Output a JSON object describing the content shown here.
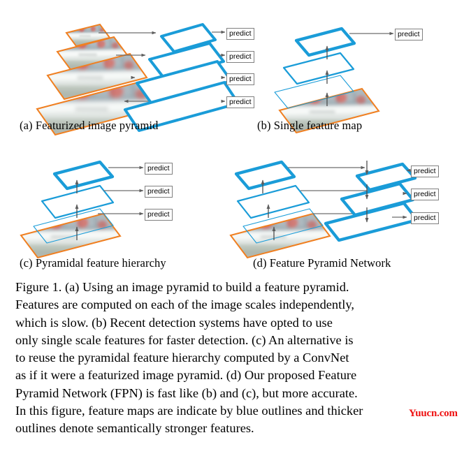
{
  "figure": {
    "number": "Figure 1.",
    "panels": [
      {
        "id": "a",
        "label": "(a) Featurized image pyramid",
        "description": "image pyramid with four orange-outlined scaled photos feeding four thick blue feature maps, each producing a predict output",
        "image_levels": 4,
        "feature_levels": 4,
        "predict_count": 4,
        "thickness": [
          "thick",
          "thick",
          "thick",
          "thick"
        ]
      },
      {
        "id": "b",
        "label": "(b) Single feature map",
        "description": "single image at bottom, convolutional stack of three blue feature maps with increasing outline thickness upward, one predict from top map",
        "image_levels": 1,
        "feature_levels": 3,
        "predict_count": 1,
        "thickness": [
          "thin",
          "medium",
          "thick"
        ]
      },
      {
        "id": "c",
        "label": "(c) Pyramidal feature hierarchy",
        "description": "single image at bottom, three blue feature maps of increasing thickness upward, each producing a predict output",
        "image_levels": 1,
        "feature_levels": 3,
        "predict_count": 3,
        "thickness": [
          "thin",
          "medium",
          "thick"
        ]
      },
      {
        "id": "d",
        "label": "(d) Feature Pyramid Network",
        "description": "bottom-up pathway on the left with increasing thickness, lateral connections to a top-down pathway on the right whose three feature maps are all thick, each producing a predict output",
        "image_levels": 1,
        "feature_levels": 3,
        "topdown_levels": 3,
        "predict_count": 3,
        "thickness": [
          "thin",
          "medium",
          "thick"
        ],
        "topdown_thickness": [
          "thick",
          "thick",
          "thick"
        ]
      }
    ],
    "predict_label": "predict",
    "caption_lines": [
      "Figure 1. (a) Using an image pyramid to build a feature pyramid.",
      "Features are computed on each of the image scales independently,",
      "which is slow.  (b) Recent detection systems have opted to use",
      "only single scale features for faster detection. (c) An alternative is",
      "to reuse the pyramidal feature hierarchy computed by a ConvNet",
      "as if it were a featurized image pyramid. (d) Our proposed Feature",
      "Pyramid Network (FPN) is fast like (b) and (c), but more accurate.",
      "In this figure, feature maps are indicate by blue outlines and thicker",
      "outlines denote semantically stronger features."
    ],
    "watermark": "Yuucn.com"
  },
  "colors": {
    "feature_blue": "#1a9cd8",
    "image_orange": "#f07f20",
    "arrow_gray": "#6e6e6e",
    "predict_border": "#808080",
    "watermark_red": "#ee1111",
    "background": "#ffffff"
  }
}
